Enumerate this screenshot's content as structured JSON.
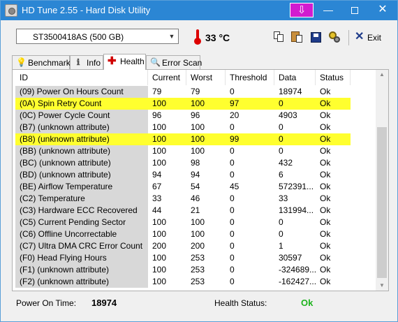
{
  "window": {
    "title": "HD Tune 2.55 - Hard Disk Utility"
  },
  "titlebar_controls": {
    "download": "⇩",
    "minimize": "—",
    "close": "✕"
  },
  "toolbar": {
    "drive": "ST3500418AS (500 GB)",
    "temperature": "33 °C",
    "exit_label": "Exit",
    "exit_icon": "✕"
  },
  "tabs": [
    {
      "label": "Benchmark",
      "icon": "bulb-icon"
    },
    {
      "label": "Info",
      "icon": "info-icon"
    },
    {
      "label": "Health",
      "icon": "health-cross-icon",
      "active": true
    },
    {
      "label": "Error Scan",
      "icon": "magnifier-icon"
    }
  ],
  "table": {
    "columns": [
      "ID",
      "Current",
      "Worst",
      "Threshold",
      "Data",
      "Status"
    ],
    "rows": [
      {
        "id": "(09) Power On Hours Count",
        "current": "79",
        "worst": "79",
        "threshold": "0",
        "data": "18974",
        "status": "Ok",
        "highlight": false
      },
      {
        "id": "(0A) Spin Retry Count",
        "current": "100",
        "worst": "100",
        "threshold": "97",
        "data": "0",
        "status": "Ok",
        "highlight": true
      },
      {
        "id": "(0C) Power Cycle Count",
        "current": "96",
        "worst": "96",
        "threshold": "20",
        "data": "4903",
        "status": "Ok",
        "highlight": false
      },
      {
        "id": "(B7) (unknown attribute)",
        "current": "100",
        "worst": "100",
        "threshold": "0",
        "data": "0",
        "status": "Ok",
        "highlight": false
      },
      {
        "id": "(B8) (unknown attribute)",
        "current": "100",
        "worst": "100",
        "threshold": "99",
        "data": "0",
        "status": "Ok",
        "highlight": true
      },
      {
        "id": "(BB) (unknown attribute)",
        "current": "100",
        "worst": "100",
        "threshold": "0",
        "data": "0",
        "status": "Ok",
        "highlight": false
      },
      {
        "id": "(BC) (unknown attribute)",
        "current": "100",
        "worst": "98",
        "threshold": "0",
        "data": "432",
        "status": "Ok",
        "highlight": false
      },
      {
        "id": "(BD) (unknown attribute)",
        "current": "94",
        "worst": "94",
        "threshold": "0",
        "data": "6",
        "status": "Ok",
        "highlight": false
      },
      {
        "id": "(BE) Airflow Temperature",
        "current": "67",
        "worst": "54",
        "threshold": "45",
        "data": "572391...",
        "status": "Ok",
        "highlight": false
      },
      {
        "id": "(C2) Temperature",
        "current": "33",
        "worst": "46",
        "threshold": "0",
        "data": "33",
        "status": "Ok",
        "highlight": false
      },
      {
        "id": "(C3) Hardware ECC Recovered",
        "current": "44",
        "worst": "21",
        "threshold": "0",
        "data": "131994...",
        "status": "Ok",
        "highlight": false
      },
      {
        "id": "(C5) Current Pending Sector",
        "current": "100",
        "worst": "100",
        "threshold": "0",
        "data": "0",
        "status": "Ok",
        "highlight": false
      },
      {
        "id": "(C6) Offline Uncorrectable",
        "current": "100",
        "worst": "100",
        "threshold": "0",
        "data": "0",
        "status": "Ok",
        "highlight": false
      },
      {
        "id": "(C7) Ultra DMA CRC Error Count",
        "current": "200",
        "worst": "200",
        "threshold": "0",
        "data": "1",
        "status": "Ok",
        "highlight": false
      },
      {
        "id": "(F0) Head Flying Hours",
        "current": "100",
        "worst": "253",
        "threshold": "0",
        "data": "30597",
        "status": "Ok",
        "highlight": false
      },
      {
        "id": "(F1) (unknown attribute)",
        "current": "100",
        "worst": "253",
        "threshold": "0",
        "data": "-324689...",
        "status": "Ok",
        "highlight": false
      },
      {
        "id": "(F2) (unknown attribute)",
        "current": "100",
        "worst": "253",
        "threshold": "0",
        "data": "-162427...",
        "status": "Ok",
        "highlight": false
      }
    ]
  },
  "footer": {
    "power_on_label": "Power On Time:",
    "power_on_value": "18974",
    "health_label": "Health Status:",
    "health_value": "Ok"
  },
  "colors": {
    "highlight": "#ffff2f",
    "health_ok": "#1db31d",
    "titlebar": "#2b86d4"
  }
}
